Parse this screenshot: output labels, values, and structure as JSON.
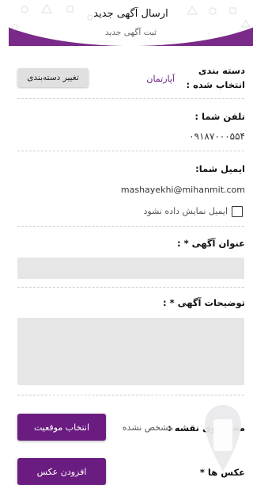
{
  "header": {
    "title": "ارسال آگهی جدید",
    "subtitle": "ثبت آگهی جدید"
  },
  "category": {
    "label": "دسته بندی انتخاب شده :",
    "value": "آپارتمان",
    "change_button": "تغییر دسته‌بندی"
  },
  "phone": {
    "label": "تلفن شما :",
    "value": "۰۹۱۸۷۰۰۰۵۵۴"
  },
  "email": {
    "label": "ایمیل شما:",
    "value": "mashayekhi@mihanmit.com",
    "hide_checkbox_label": "ایمیل نمایش داده نشود"
  },
  "ad_title": {
    "label": "عنوان آگهی * :",
    "value": ""
  },
  "description": {
    "label": "توضیحات آگهی * :",
    "value": ""
  },
  "location": {
    "label": "محل روی نقشه :",
    "status": "مشخص نشده",
    "button": "انتخاب موقعیت"
  },
  "photos": {
    "label": "عکس ها *",
    "button": "افزودن عکس"
  },
  "colors": {
    "accent": "#6a1c80",
    "header_band": "#7a2a88"
  },
  "icons": [
    "map-pin-icon",
    "checkbox-icon"
  ]
}
